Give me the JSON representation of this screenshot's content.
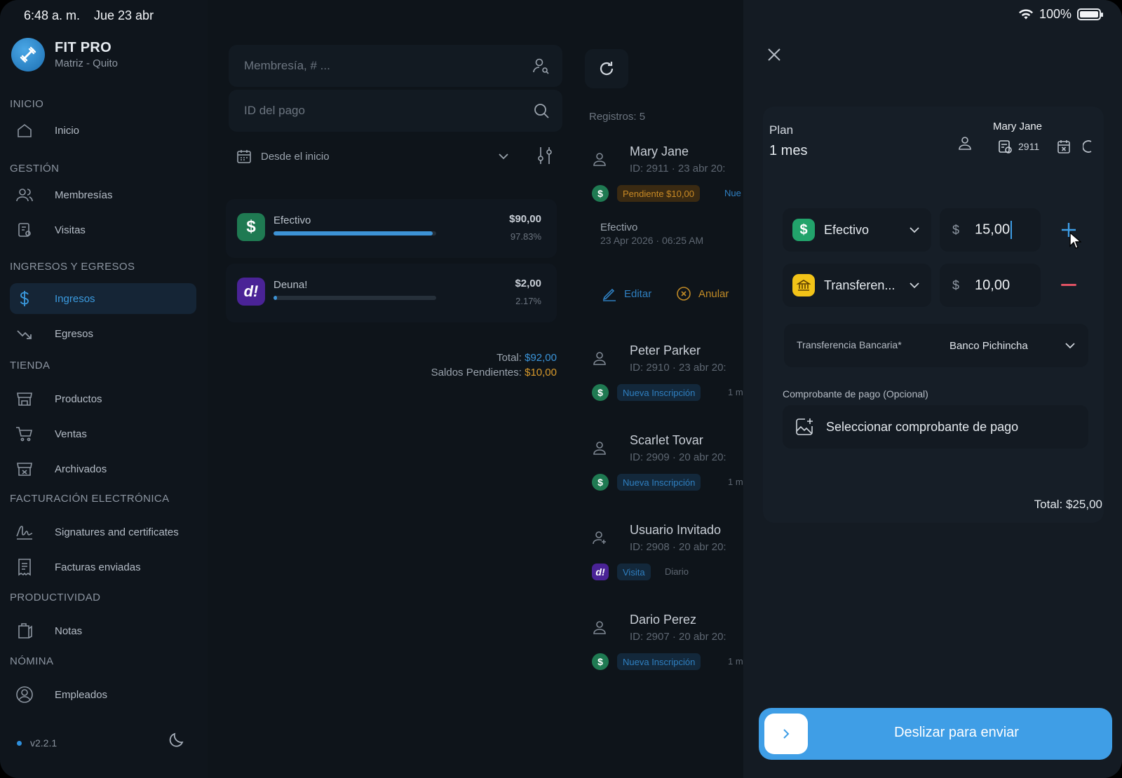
{
  "status": {
    "time": "6:48 a. m.",
    "date": "Jue 23 abr",
    "battery": "100%"
  },
  "brand": {
    "name": "FIT PRO",
    "subtitle": "Matriz - Quito"
  },
  "sidebar": {
    "sections": [
      {
        "title": "INICIO",
        "items": [
          {
            "label": "Inicio",
            "icon": "home-icon"
          }
        ]
      },
      {
        "title": "GESTIÓN",
        "items": [
          {
            "label": "Membresías",
            "icon": "users-icon"
          },
          {
            "label": "Visitas",
            "icon": "visits-icon"
          }
        ]
      },
      {
        "title": "INGRESOS Y EGRESOS",
        "items": [
          {
            "label": "Ingresos",
            "icon": "dollar-icon",
            "active": true
          },
          {
            "label": "Egresos",
            "icon": "trend-down-icon"
          }
        ]
      },
      {
        "title": "TIENDA",
        "items": [
          {
            "label": "Productos",
            "icon": "store-icon"
          },
          {
            "label": "Ventas",
            "icon": "cart-icon"
          },
          {
            "label": "Archivados",
            "icon": "archive-store-icon"
          }
        ]
      },
      {
        "title": "FACTURACIÓN ELECTRÓNICA",
        "items": [
          {
            "label": "Signatures and certificates",
            "icon": "signature-icon"
          },
          {
            "label": "Facturas enviadas",
            "icon": "invoice-icon"
          }
        ]
      },
      {
        "title": "PRODUCTIVIDAD",
        "items": [
          {
            "label": "Notas",
            "icon": "notes-icon"
          }
        ]
      },
      {
        "title": "NÓMINA",
        "items": [
          {
            "label": "Empleados",
            "icon": "employee-icon"
          }
        ]
      }
    ],
    "version": "v2.2.1"
  },
  "filters": {
    "membership_placeholder": "Membresía, # ...",
    "payment_id_placeholder": "ID del pago",
    "date_range": "Desde el inicio"
  },
  "payment_summary": {
    "methods": [
      {
        "name": "Efectivo",
        "amount": "$90,00",
        "percent": "97.83%",
        "share": 0.9783,
        "color": "#22a36b",
        "icon": "$"
      },
      {
        "name": "Deuna!",
        "amount": "$2,00",
        "percent": "2.17%",
        "share": 0.0217,
        "color": "#5a2bb5",
        "icon": "d!"
      }
    ],
    "total_label": "Total:",
    "total_value": "$92,00",
    "pending_label": "Saldos Pendientes:",
    "pending_value": "$10,00"
  },
  "records": {
    "count_label": "Registros: 5",
    "items": [
      {
        "name": "Mary Jane",
        "id": "ID: 2911  ·  23 abr 20:",
        "tag": "Pendiente $10,00",
        "tag2": "Nue",
        "extra": "",
        "method": "cash"
      },
      {
        "name": "Peter Parker",
        "id": "ID: 2910  ·  23 abr 20:",
        "tag": "Nueva Inscripción",
        "extra": "1 m",
        "method": "cash"
      },
      {
        "name": "Scarlet Tovar",
        "id": "ID: 2909  ·  20 abr 20:",
        "tag": "Nueva Inscripción",
        "extra": "1 m",
        "method": "cash"
      },
      {
        "name": "Usuario Invitado",
        "id": "ID: 2908  ·  20 abr 20:",
        "tag": "Visita",
        "extra": "Diario",
        "method": "deuna"
      },
      {
        "name": "Dario Perez",
        "id": "ID: 2907  ·  20 abr 20:",
        "tag": "Nueva Inscripción",
        "extra": "1 m",
        "method": "cash"
      }
    ],
    "expanded": {
      "method": "Efectivo",
      "datetime": "23 Apr 2026 · 06:25 AM",
      "edit_label": "Editar",
      "void_label": "Anular"
    }
  },
  "panel": {
    "plan_label": "Plan",
    "plan_value": "1 mes",
    "member_name": "Mary Jane",
    "member_id": "2911",
    "payments": [
      {
        "method": "Efectivo",
        "currency": "$",
        "amount": "15,00",
        "color": "#22a36b",
        "icon": "$"
      },
      {
        "method": "Transferen...",
        "currency": "$",
        "amount": "10,00",
        "color": "#f2c318",
        "icon": "bank"
      }
    ],
    "bank_label": "Transferencia Bancaria*",
    "bank_value": "Banco Pichincha",
    "receipt_label": "Comprobante de pago (Opcional)",
    "receipt_button": "Seleccionar comprobante de pago",
    "total": "Total: $25,00",
    "slide_label": "Deslizar para enviar"
  }
}
